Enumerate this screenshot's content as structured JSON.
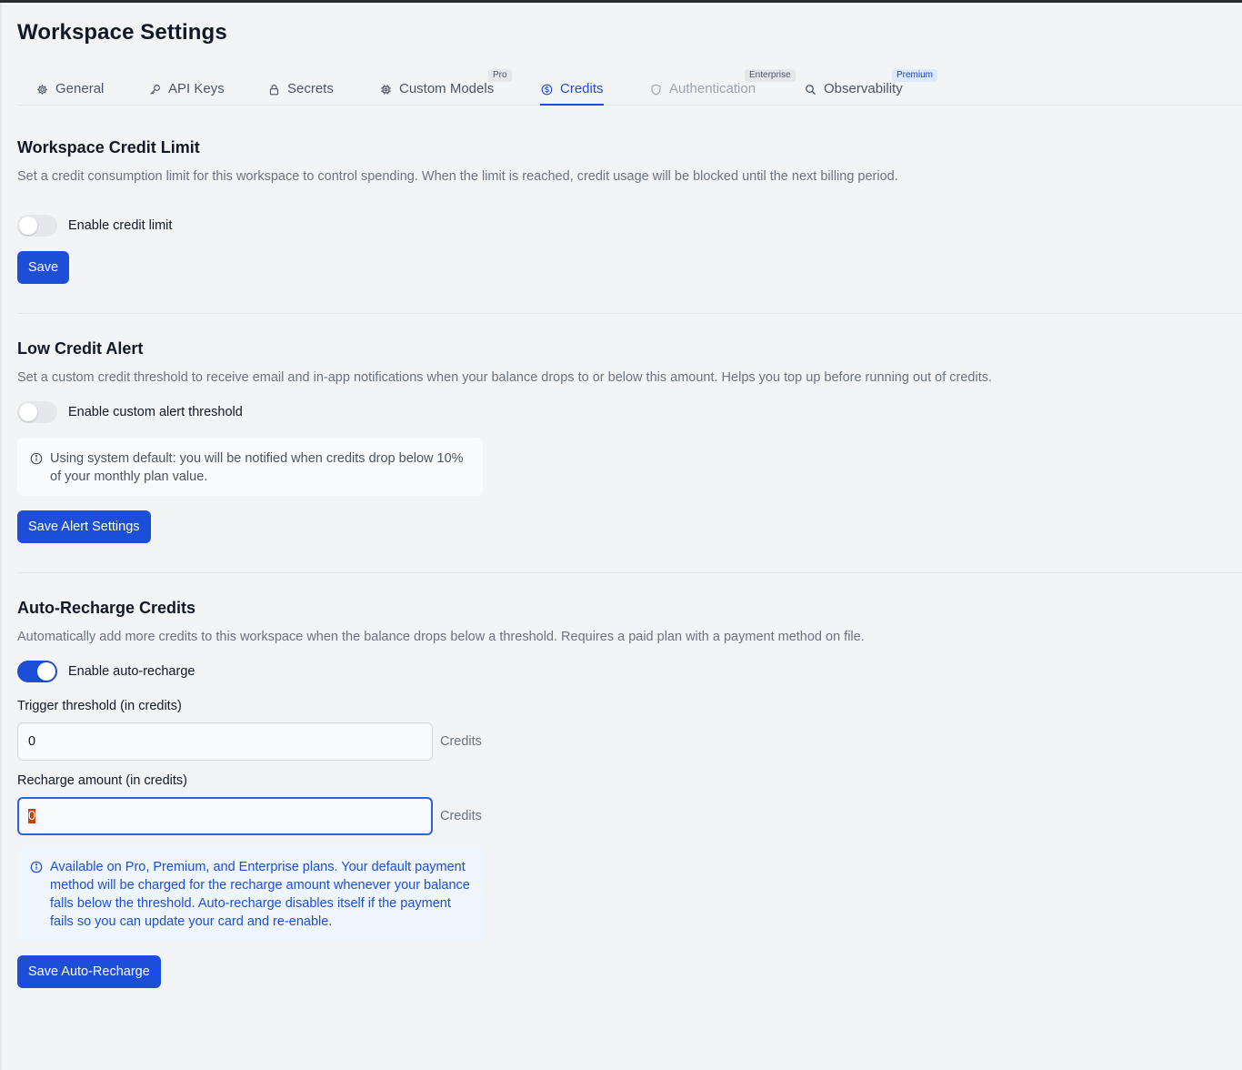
{
  "page": {
    "title": "Workspace Settings"
  },
  "tabs": [
    {
      "label": "General",
      "icon": "gear-icon"
    },
    {
      "label": "API Keys",
      "icon": "key-icon"
    },
    {
      "label": "Secrets",
      "icon": "lock-icon"
    },
    {
      "label": "Custom Models",
      "icon": "chip-icon",
      "badge": "Pro"
    },
    {
      "label": "Credits",
      "icon": "dollar-circle-icon",
      "active": true
    },
    {
      "label": "Authentication",
      "icon": "shield-icon",
      "badge": "Enterprise",
      "disabled": true
    },
    {
      "label": "Observability",
      "icon": "search-icon",
      "badge": "Premium"
    }
  ],
  "credit_limit": {
    "title": "Workspace Credit Limit",
    "description": "Set a credit consumption limit for this workspace to control spending. When the limit is reached, credit usage will be blocked until the next billing period.",
    "toggle_label": "Enable credit limit",
    "enabled": false,
    "save_label": "Save"
  },
  "low_alert": {
    "title": "Low Credit Alert",
    "description": "Set a custom credit threshold to receive email and in-app notifications when your balance drops to or below this amount. Helps you top up before running out of credits.",
    "toggle_label": "Enable custom alert threshold",
    "enabled": false,
    "info": "Using system default: you will be notified when credits drop below 10% of your monthly plan value.",
    "save_label": "Save Alert Settings"
  },
  "auto_recharge": {
    "title": "Auto-Recharge Credits",
    "description": "Automatically add more credits to this workspace when the balance drops below a threshold. Requires a paid plan with a payment method on file.",
    "toggle_label": "Enable auto-recharge",
    "enabled": true,
    "threshold_label": "Trigger threshold (in credits)",
    "threshold_value": "0",
    "amount_label": "Recharge amount (in credits)",
    "amount_value": "0",
    "unit": "Credits",
    "info": "Available on Pro, Premium, and Enterprise plans. Your default payment method will be charged for the recharge amount whenever your balance falls below the threshold. Auto-recharge disables itself if the payment fails so you can update your card and re-enable.",
    "save_label": "Save Auto-Recharge"
  },
  "colors": {
    "accent": "#1d4ed8",
    "background": "#f3f4f6"
  }
}
